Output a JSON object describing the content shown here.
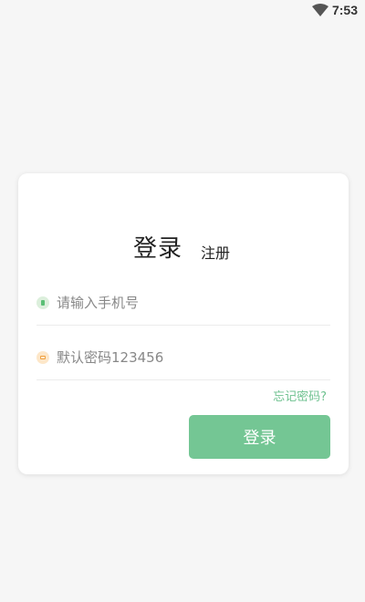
{
  "status_bar": {
    "time": "7:53",
    "wifi_icon": "wifi-icon"
  },
  "card": {
    "tabs": {
      "login": "登录",
      "register": "注册"
    },
    "phone_field": {
      "icon": "phone-icon",
      "placeholder": "请输入手机号",
      "value": ""
    },
    "password_field": {
      "icon": "lock-icon",
      "placeholder": "默认密码123456",
      "value": ""
    },
    "forgot_password": "忘记密码?",
    "login_button": "登录"
  },
  "colors": {
    "accent": "#74c694",
    "link": "#6fc290",
    "background": "#f6f6f6"
  }
}
